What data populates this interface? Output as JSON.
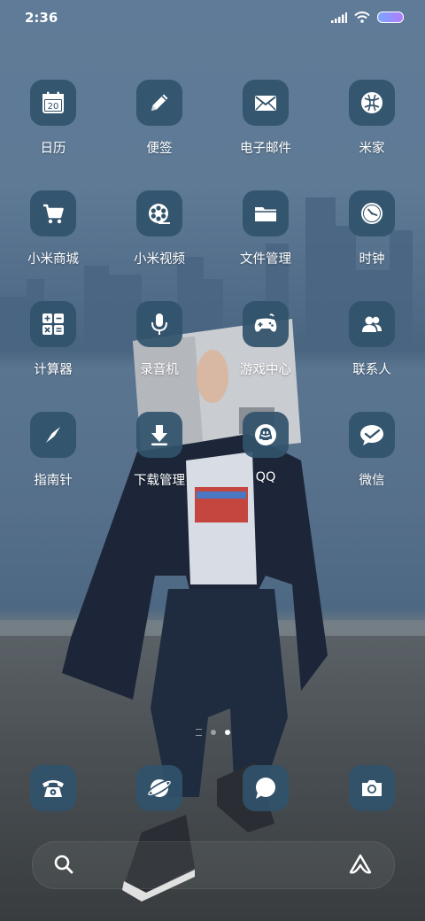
{
  "status_bar": {
    "time": "2:36"
  },
  "apps": [
    [
      {
        "label": "日历",
        "icon": "calendar-icon",
        "calendar_day": "20"
      },
      {
        "label": "便签",
        "icon": "pencil-icon"
      },
      {
        "label": "电子邮件",
        "icon": "mail-icon"
      },
      {
        "label": "米家",
        "icon": "mijia-icon"
      }
    ],
    [
      {
        "label": "小米商城",
        "icon": "cart-icon"
      },
      {
        "label": "小米视频",
        "icon": "film-reel-icon"
      },
      {
        "label": "文件管理",
        "icon": "folder-icon"
      },
      {
        "label": "时钟",
        "icon": "clock-icon"
      }
    ],
    [
      {
        "label": "计算器",
        "icon": "calculator-icon"
      },
      {
        "label": "录音机",
        "icon": "microphone-icon"
      },
      {
        "label": "游戏中心",
        "icon": "gamepad-icon"
      },
      {
        "label": "联系人",
        "icon": "contacts-icon"
      }
    ],
    [
      {
        "label": "指南针",
        "icon": "compass-icon"
      },
      {
        "label": "下载管理",
        "icon": "download-icon"
      },
      {
        "label": "QQ",
        "icon": "qq-icon"
      },
      {
        "label": "微信",
        "icon": "wechat-icon"
      }
    ]
  ],
  "dock": [
    {
      "icon": "phone-icon"
    },
    {
      "icon": "browser-icon"
    },
    {
      "icon": "message-icon"
    },
    {
      "icon": "camera-icon"
    }
  ],
  "pager": {
    "pages": 2,
    "active": 2
  },
  "colors": {
    "tile": "#31526b",
    "accent": "#ffffff"
  }
}
